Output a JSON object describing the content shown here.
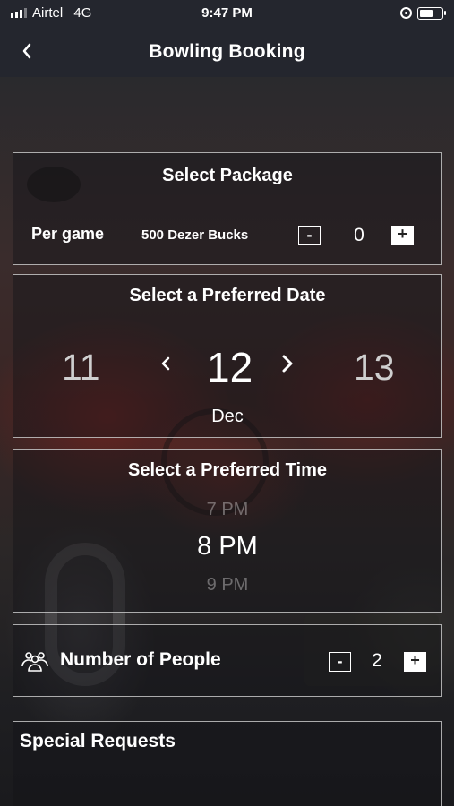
{
  "status_bar": {
    "carrier": "Airtel",
    "network": "4G",
    "time": "9:47 PM",
    "battery_level": 0.65,
    "icons": [
      "signal-icon",
      "rotation-lock-icon",
      "battery-icon"
    ]
  },
  "nav": {
    "back_icon": "chevron-left-icon",
    "title": "Bowling Booking"
  },
  "package": {
    "title": "Select Package",
    "name": "Per game",
    "price": "500 Dezer Bucks",
    "minus": "-",
    "quantity": "0",
    "plus": "+"
  },
  "date": {
    "title": "Select a Preferred Date",
    "prev_day": "11",
    "selected_day": "12",
    "next_day": "13",
    "prev_arrow": "‹",
    "next_arrow": "›",
    "month": "Dec"
  },
  "time": {
    "title": "Select a Preferred Time",
    "previous": "7 PM",
    "selected": "8 PM",
    "next": "9 PM"
  },
  "people": {
    "icon": "people-icon",
    "label": "Number of People",
    "minus": "-",
    "count": "2",
    "plus": "+"
  },
  "requests": {
    "label": "Special Requests"
  },
  "colors": {
    "nav_background": "#24262e",
    "card_border": "#dcdcdc",
    "text": "#ffffff"
  }
}
